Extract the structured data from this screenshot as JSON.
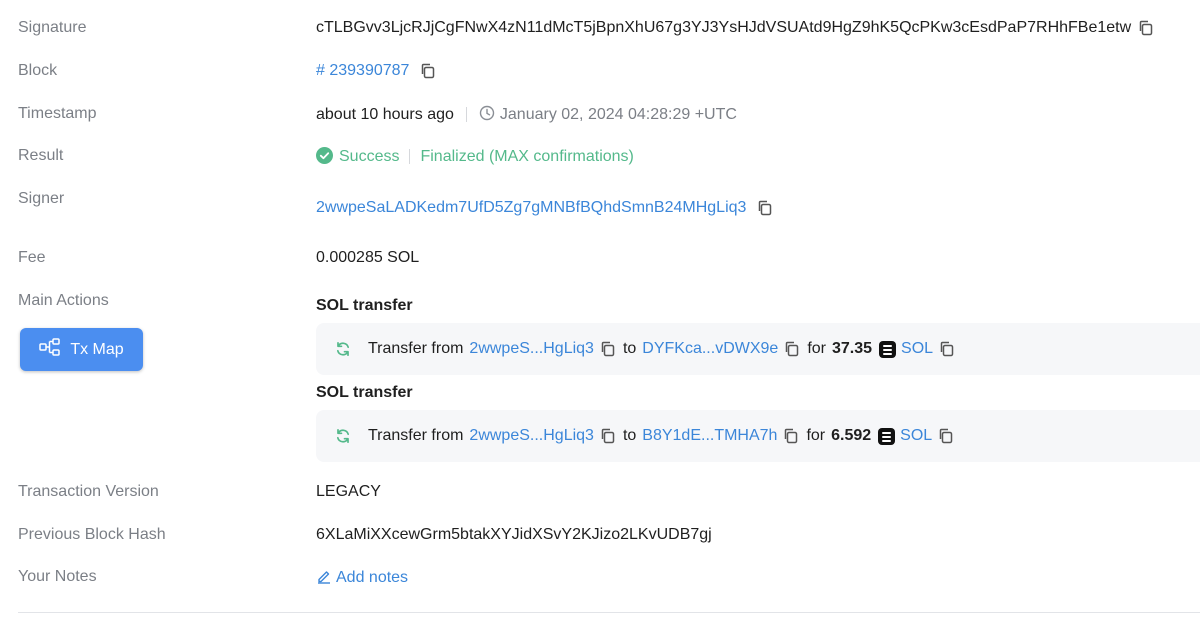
{
  "labels": {
    "signature": "Signature",
    "block": "Block",
    "timestamp": "Timestamp",
    "result": "Result",
    "signer": "Signer",
    "fee": "Fee",
    "main_actions": "Main Actions",
    "tx_version": "Transaction Version",
    "prev_block_hash": "Previous Block Hash",
    "your_notes": "Your Notes"
  },
  "signature": "cTLBGvv3LjcRJjCgFNwX4zN11dMcT5jBpnXhU67g3YJ3YsHJdVSUAtd9HgZ9hK5QcPKw3cEsdPaP7RHhFBe1etw",
  "block": "# 239390787",
  "timestamp": {
    "relative": "about 10 hours ago",
    "absolute": "January 02, 2024 04:28:29 +UTC"
  },
  "result": {
    "status": "Success",
    "finality": "Finalized (MAX confirmations)"
  },
  "signer": "2wwpeSaLADKedm7UfD5Zg7gMNBfBQhdSmnB24MHgLiq3",
  "fee": "0.000285 SOL",
  "tx_map_button": "Tx Map",
  "actions": [
    {
      "title": "SOL transfer",
      "prefix": "Transfer from",
      "from": "2wwpeS...HgLiq3",
      "to_word": "to",
      "to": "DYFKca...vDWX9e",
      "for_word": "for",
      "amount": "37.35",
      "token": "SOL"
    },
    {
      "title": "SOL transfer",
      "prefix": "Transfer from",
      "from": "2wwpeS...HgLiq3",
      "to_word": "to",
      "to": "B8Y1dE...TMHA7h",
      "for_word": "for",
      "amount": "6.592",
      "token": "SOL"
    }
  ],
  "tx_version": "LEGACY",
  "prev_block_hash": "6XLaMiXXcewGrm5btakXYJidXSvY2KJizo2LKvUDB7gj",
  "notes_link": "Add notes",
  "colors": {
    "link": "#3b86d9",
    "success": "#54b98b",
    "label": "#7b7f86",
    "button": "#4b8ef0"
  }
}
